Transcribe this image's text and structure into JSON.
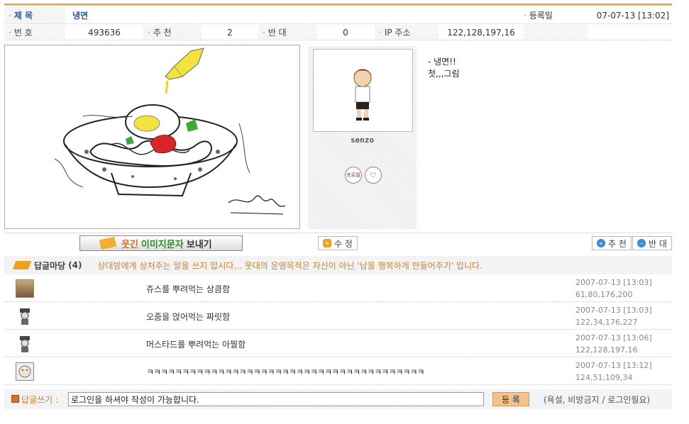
{
  "header": {
    "title_label": "제 목",
    "title_value": "냉면",
    "date_label": "등록일",
    "date_value": "07-07-13 [13:02]",
    "num_label": "번 호",
    "num_value": "493636",
    "rec_label": "추 천",
    "rec_value": "2",
    "opp_label": "반 대",
    "opp_value": "0",
    "ip_label": "IP 주소",
    "ip_value": "122,128,197,16"
  },
  "profile": {
    "username": "senzo",
    "badge1": "프로필",
    "badge2": "♡"
  },
  "content": {
    "line1": "- 냉면!!",
    "line2": "첫,,,그림"
  },
  "actions": {
    "image_btn_prefix": "웃긴",
    "image_btn_main": "이미지문자",
    "image_btn_suffix": "보내기",
    "edit_label": "수 정",
    "recommend_label": "추 천",
    "oppose_label": "반 대"
  },
  "replies_header": {
    "title": "답글마당",
    "count": "(4)",
    "notice": "상대방에게 상처주는 말을 쓰지 맙시다... 웃대의 운영목적은 자신이 아닌 '남을 행복하게 만들어주기' 입니다."
  },
  "replies": [
    {
      "text": "쥬스를 뿌려먹는 상큼함",
      "time": "2007-07-13 [13:03]",
      "ip": "61,80,176,200",
      "avatar": "photo-avatar"
    },
    {
      "text": "오줌을 얹어먹는 짜릿함",
      "time": "2007-07-13 [13:03]",
      "ip": "122,34,176,227",
      "avatar": "hat-avatar"
    },
    {
      "text": "머스타드를 뿌려먹는 아찔함",
      "time": "2007-07-13 [13:06]",
      "ip": "122,128,197,16",
      "avatar": "hat-avatar"
    },
    {
      "text": "ㅋㅋㅋㅋㅋㅋㅋㅋㅋㅋㅋㅋㅋㅋㅋㅋㅋㅋㅋㅋㅋㅋㅋㅋㅋㅋㅋㅋㅋㅋㅋㅋㅋㅋㅋㅋㅋㅋㅋ",
      "time": "2007-07-13 [13:12]",
      "ip": "124,51,109,34",
      "avatar": "face-avatar"
    }
  ],
  "write": {
    "label": "답글쓰기 :",
    "value": "로그인을 하셔야 작성이 가능합니다.",
    "submit": "등 록",
    "warning": "(욕설, 비방금지 / 로그인필요)"
  },
  "colors": {
    "accent": "#e8a04a",
    "title_blue": "#2a56a8",
    "notice": "#c9842c"
  }
}
